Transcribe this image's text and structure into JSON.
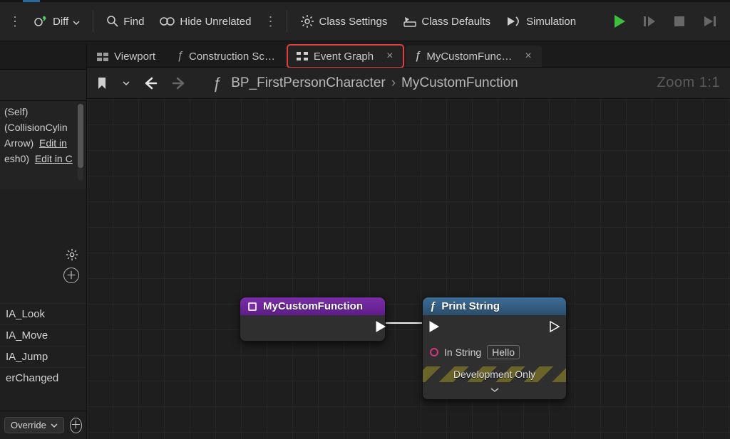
{
  "toolbar": {
    "diff": "Diff",
    "find": "Find",
    "hide_unrelated": "Hide Unrelated",
    "class_settings": "Class Settings",
    "class_defaults": "Class Defaults",
    "simulation": "Simulation"
  },
  "tabs": {
    "viewport": "Viewport",
    "construction": "Construction Sc…",
    "event_graph": "Event Graph",
    "custom_func": "MyCustomFunc…"
  },
  "breadcrumb": {
    "root": "BP_FirstPersonCharacter",
    "leaf": "MyCustomFunction"
  },
  "zoom_label": "Zoom 1:1",
  "components": {
    "c0": "(Self)",
    "c1": "(CollisionCylin",
    "c2_a": "Arrow)",
    "c2_b": "Edit in",
    "c3_a": "esh0)",
    "c3_b": "Edit in C"
  },
  "variables": {
    "v0": "IA_Look",
    "v1": "IA_Move",
    "v2": "IA_Jump",
    "v3": "erChanged"
  },
  "override_label": "Override",
  "nodes": {
    "func": {
      "title": "MyCustomFunction"
    },
    "print": {
      "title": "Print String",
      "in_string_label": "In String",
      "in_string_value": "Hello",
      "dev_only": "Development Only"
    }
  }
}
